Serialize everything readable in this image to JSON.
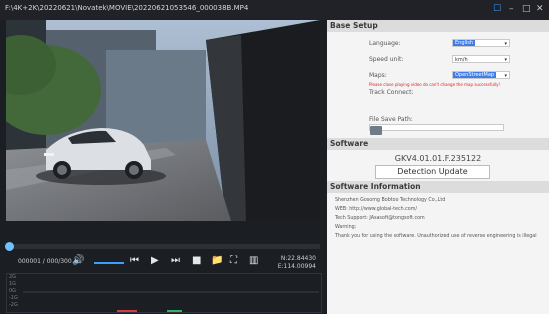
{
  "window": {
    "title": "F:\\4K+2K\\20220621\\Novatek\\MOVIE\\20220621053546_000038B.MP4",
    "buttons": [
      "☐",
      "–",
      "□",
      "✕"
    ]
  },
  "player": {
    "time": "000001 / 000/300",
    "coords": {
      "lat": "N:22.84430",
      "lon": "E:114.00994"
    },
    "progress_percent": 1,
    "graph_labels": [
      "2G",
      "1G",
      "0G",
      "-1G",
      "-2G"
    ]
  },
  "settings": {
    "base_setup_label": "Base Setup",
    "language_label": "Language:",
    "language_value": "English",
    "speed_unit_label": "Speed unit:",
    "speed_unit_value": "km/h",
    "maps_label": "Maps:",
    "maps_value": "OpenStreetMap",
    "maps_warning": "Please close playing video do can't change the map successfully!",
    "track_connect_label": "Track Connect:",
    "file_save_path_label": "File Save Path:",
    "software_label": "Software",
    "version": "GKV4.01.01.F.235122",
    "detection_update": "Detection Update",
    "software_info_label": "Software Information",
    "info_lines": [
      "Shenzhen Gosomg Bobtoo Technology Co.,Ltd",
      "WEB: http://www.global-tech.com/",
      "Tech Support: JAsasoft@tongsoft.com",
      "Warning:",
      "Thank you for using the software. Unauthorized use of reverse engineering is illegal"
    ]
  }
}
